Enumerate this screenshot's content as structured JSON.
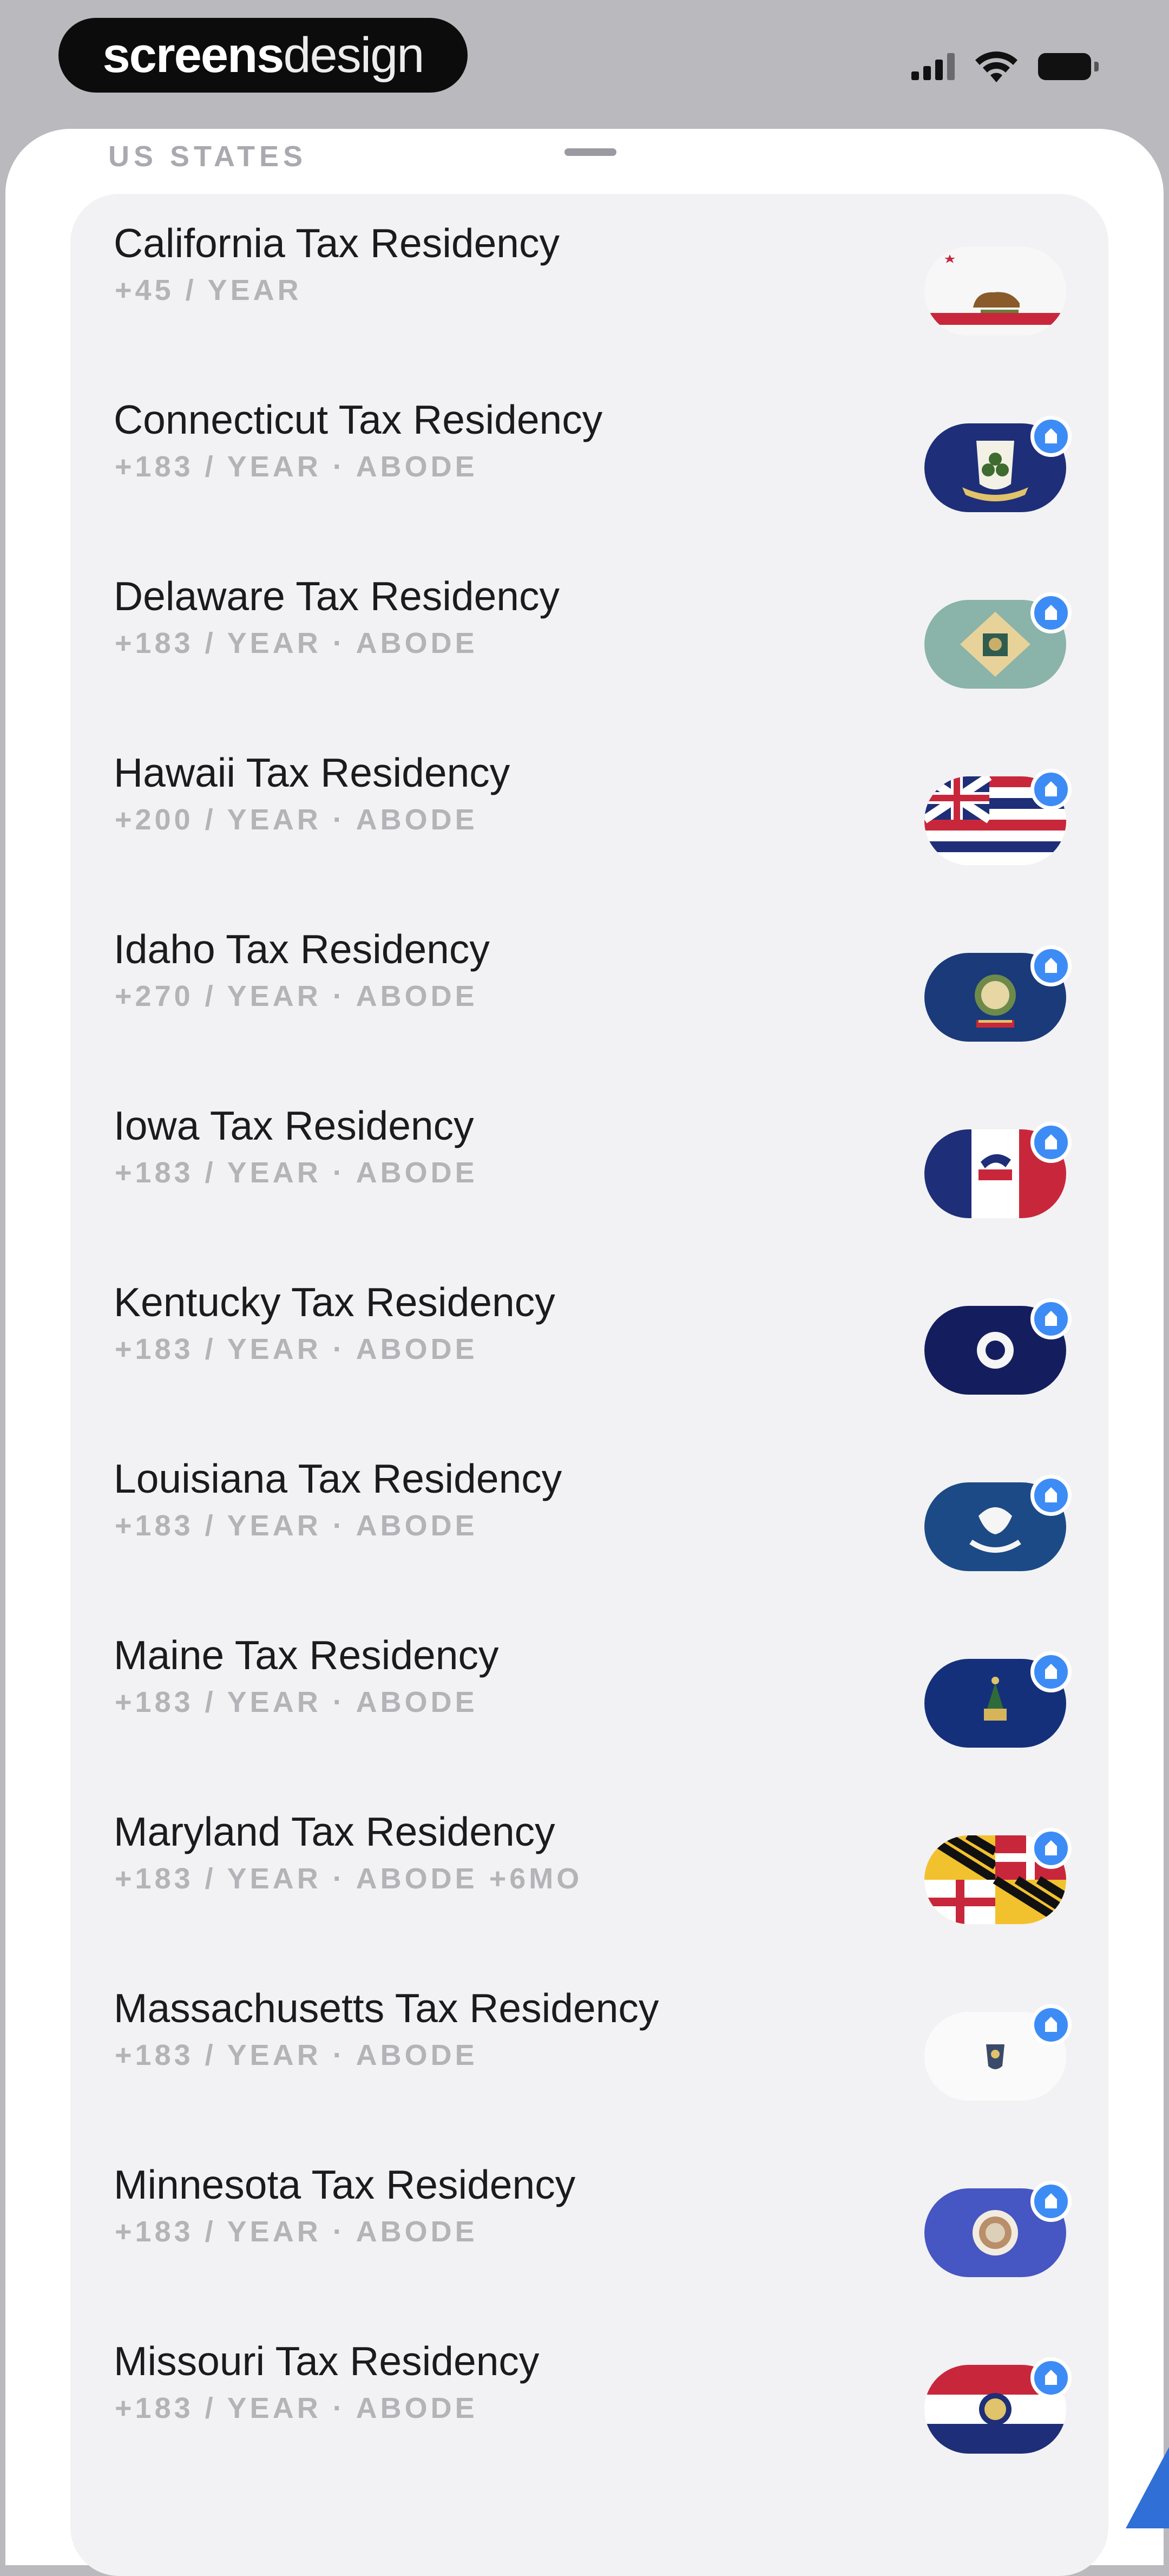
{
  "status_bar": {
    "brand_bold": "screens",
    "brand_light": "design",
    "signal_icon": "cellular-signal-icon",
    "wifi_icon": "wifi-icon",
    "battery_icon": "battery-icon"
  },
  "sheet": {
    "section_header": "US STATES"
  },
  "colors": {
    "accent": "#3d8cf5",
    "title": "#1b1b1d",
    "subtitle": "#b3b3b8",
    "card": "#f2f2f4"
  },
  "rows": [
    {
      "title": "California Tax Residency",
      "subtitle": "+45 / YEAR",
      "flag": "california-flag-icon",
      "badge": false
    },
    {
      "title": "Connecticut Tax Residency",
      "subtitle": "+183 / YEAR · ABODE",
      "flag": "connecticut-flag-icon",
      "badge": true
    },
    {
      "title": "Delaware Tax Residency",
      "subtitle": "+183 / YEAR · ABODE",
      "flag": "delaware-flag-icon",
      "badge": true
    },
    {
      "title": "Hawaii Tax Residency",
      "subtitle": "+200 / YEAR · ABODE",
      "flag": "hawaii-flag-icon",
      "badge": true
    },
    {
      "title": "Idaho Tax Residency",
      "subtitle": "+270 / YEAR · ABODE",
      "flag": "idaho-flag-icon",
      "badge": true
    },
    {
      "title": "Iowa Tax Residency",
      "subtitle": "+183 / YEAR · ABODE",
      "flag": "iowa-flag-icon",
      "badge": true
    },
    {
      "title": "Kentucky Tax Residency",
      "subtitle": "+183 / YEAR · ABODE",
      "flag": "kentucky-flag-icon",
      "badge": true
    },
    {
      "title": "Louisiana Tax Residency",
      "subtitle": "+183 / YEAR · ABODE",
      "flag": "louisiana-flag-icon",
      "badge": true
    },
    {
      "title": "Maine Tax Residency",
      "subtitle": "+183 / YEAR · ABODE",
      "flag": "maine-flag-icon",
      "badge": true
    },
    {
      "title": "Maryland Tax Residency",
      "subtitle": "+183 / YEAR · ABODE +6MO",
      "flag": "maryland-flag-icon",
      "badge": true
    },
    {
      "title": "Massachusetts Tax Residency",
      "subtitle": "+183 / YEAR · ABODE",
      "flag": "massachusetts-flag-icon",
      "badge": true
    },
    {
      "title": "Minnesota Tax Residency",
      "subtitle": "+183 / YEAR · ABODE",
      "flag": "minnesota-flag-icon",
      "badge": true
    },
    {
      "title": "Missouri Tax Residency",
      "subtitle": "+183 / YEAR · ABODE",
      "flag": "missouri-flag-icon",
      "badge": true
    }
  ]
}
